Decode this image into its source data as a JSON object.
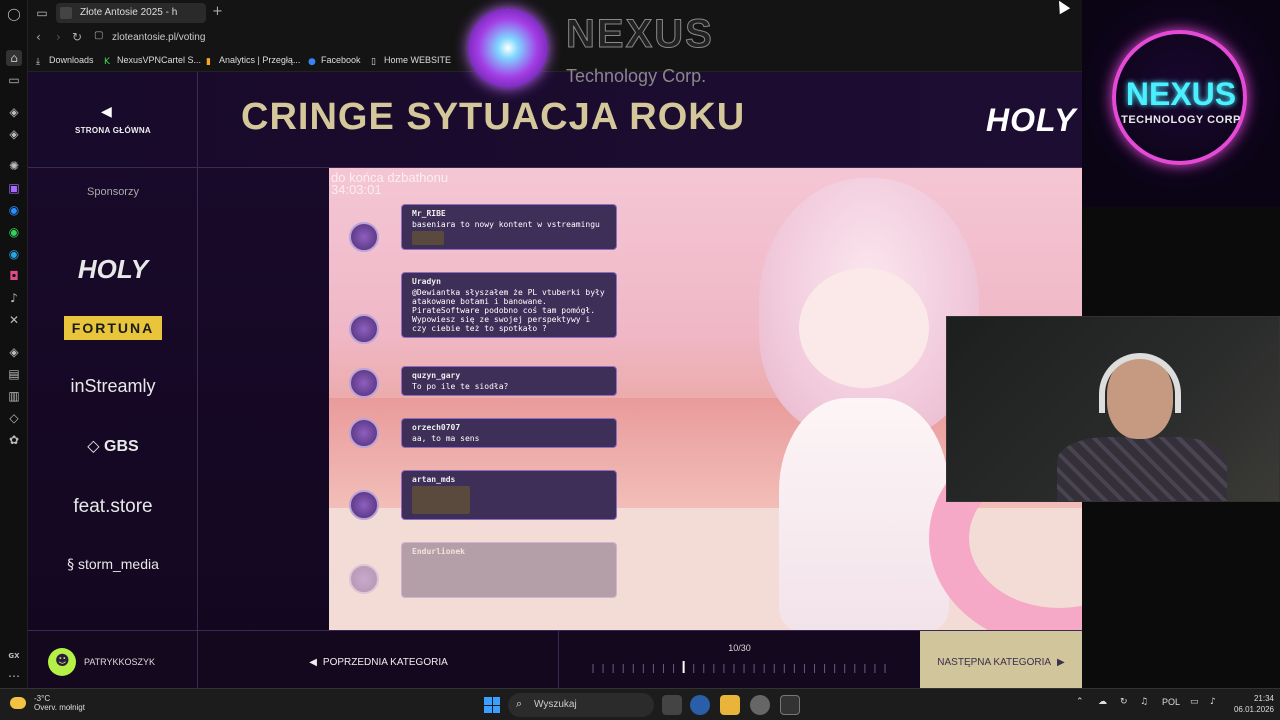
{
  "browser": {
    "tab_title": "Złote Antosie 2025 - h",
    "url": "zloteantosie.pl/voting",
    "bookmarks": [
      "Downloads",
      "NexusVPNCartel S...",
      "Analytics | Przegłą...",
      "Facebook",
      "Home WEBSITE"
    ]
  },
  "page": {
    "home_label": "STRONA GŁÓWNA",
    "category_title": "CRINGE SYTUACJA ROKU",
    "header_sponsor": "HOLY",
    "sponsors_title": "Sponsorzy",
    "sponsors": [
      "HOLY",
      "FORTUNA",
      "inStreamly",
      "GBS",
      "feat.store",
      "storm_media"
    ]
  },
  "overlay": {
    "nexus_title": "NEXUS",
    "nexus_sub": "Technology Corp.",
    "nexus_box_title": "NEXUS",
    "nexus_box_sub": "TECHNOLOGY CORP"
  },
  "video": {
    "timer": "do końca dzbathonu",
    "timer_value": "34:03:01",
    "chat": [
      {
        "user": "Mr_RIBE",
        "text": "baseniara to nowy kontent w vstreamingu",
        "emote": true
      },
      {
        "user": "Uradyn",
        "text": "@Dewiantka słyszałem że PL vtuberki były atakowane botami i banowane. PirateSoftware podobno coś tam pomógł. Wypowiesz się ze swojej perspektywy i czy ciebie też to spotkało ?",
        "emote": false
      },
      {
        "user": "quzyn_gary",
        "text": "To po ile te siodła?",
        "emote": false
      },
      {
        "user": "orzech0707",
        "text": "aa, to ma sens",
        "emote": false
      },
      {
        "user": "artan_mds",
        "text": "",
        "emote": true
      },
      {
        "user": "Endurlionek",
        "text": "",
        "emote": false
      }
    ]
  },
  "footer": {
    "username": "PATRYKKOSZYK",
    "prev_label": "POPRZEDNIA KATEGORIA",
    "progress_current": 10,
    "progress_total": 30,
    "progress_label": "10/30",
    "next_label": "NASTĘPNA KATEGORIA"
  },
  "taskbar": {
    "weather_temp": "-3°C",
    "weather_desc": "Overv. mołnigt",
    "search_placeholder": "Wyszukaj",
    "lang": "POL",
    "time": "21:34",
    "date": "06.01.2026"
  },
  "colors": {
    "accent_gold": "#d4c79a",
    "page_bg": "#1a0a2c",
    "nexus_cyan": "#4af0ff"
  }
}
